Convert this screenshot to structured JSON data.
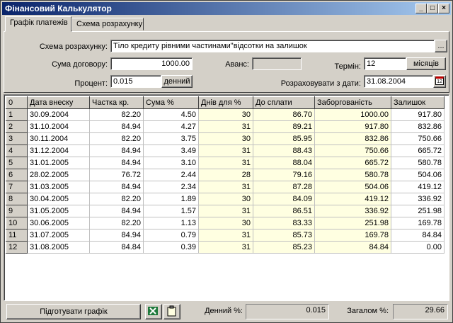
{
  "window": {
    "title": "Фінансовий Калькулятор"
  },
  "tabs": [
    {
      "label": "Графік платежів"
    },
    {
      "label": "Схема розрахунку"
    }
  ],
  "form": {
    "scheme_label": "Схема розрахунку:",
    "scheme_value": "Тіло кредиту рівними частинами\"відсотки на залишок",
    "scheme_button": "...",
    "amount_label": "Сума договору:",
    "amount_value": "1000.00",
    "advance_label": "Аванс:",
    "advance_value": "",
    "term_label": "Термін:",
    "term_value": "12",
    "term_unit": "місяців",
    "percent_label": "Процент:",
    "percent_value": "0.015",
    "percent_unit": "денний",
    "date_label": "Розраховувати з дати:",
    "date_value": "31.08.2004",
    "date_icon_text": "12"
  },
  "table": {
    "headers": [
      "0",
      "Дата внеску",
      "Частка кр.",
      "Сума %",
      "Днів для %",
      "До сплати",
      "Заборгованість",
      "Залишок"
    ],
    "rows": [
      [
        "1",
        "30.09.2004",
        "82.20",
        "4.50",
        "30",
        "86.70",
        "1000.00",
        "917.80"
      ],
      [
        "2",
        "31.10.2004",
        "84.94",
        "4.27",
        "31",
        "89.21",
        "917.80",
        "832.86"
      ],
      [
        "3",
        "30.11.2004",
        "82.20",
        "3.75",
        "30",
        "85.95",
        "832.86",
        "750.66"
      ],
      [
        "4",
        "31.12.2004",
        "84.94",
        "3.49",
        "31",
        "88.43",
        "750.66",
        "665.72"
      ],
      [
        "5",
        "31.01.2005",
        "84.94",
        "3.10",
        "31",
        "88.04",
        "665.72",
        "580.78"
      ],
      [
        "6",
        "28.02.2005",
        "76.72",
        "2.44",
        "28",
        "79.16",
        "580.78",
        "504.06"
      ],
      [
        "7",
        "31.03.2005",
        "84.94",
        "2.34",
        "31",
        "87.28",
        "504.06",
        "419.12"
      ],
      [
        "8",
        "30.04.2005",
        "82.20",
        "1.89",
        "30",
        "84.09",
        "419.12",
        "336.92"
      ],
      [
        "9",
        "31.05.2005",
        "84.94",
        "1.57",
        "31",
        "86.51",
        "336.92",
        "251.98"
      ],
      [
        "10",
        "30.06.2005",
        "82.20",
        "1.13",
        "30",
        "83.33",
        "251.98",
        "169.78"
      ],
      [
        "11",
        "31.07.2005",
        "84.94",
        "0.79",
        "31",
        "85.73",
        "169.78",
        "84.84"
      ],
      [
        "12",
        "31.08.2005",
        "84.84",
        "0.39",
        "31",
        "85.23",
        "84.84",
        "0.00"
      ]
    ]
  },
  "status": {
    "prepare_button": "Підготувати графік",
    "daily_label": "Денний %:",
    "daily_value": "0.015",
    "total_label": "Загалом %:",
    "total_value": "29.66"
  },
  "colors": {
    "title_start": "#0a246a",
    "title_end": "#a6caf0",
    "highlight_cells": "#ffffe1"
  }
}
